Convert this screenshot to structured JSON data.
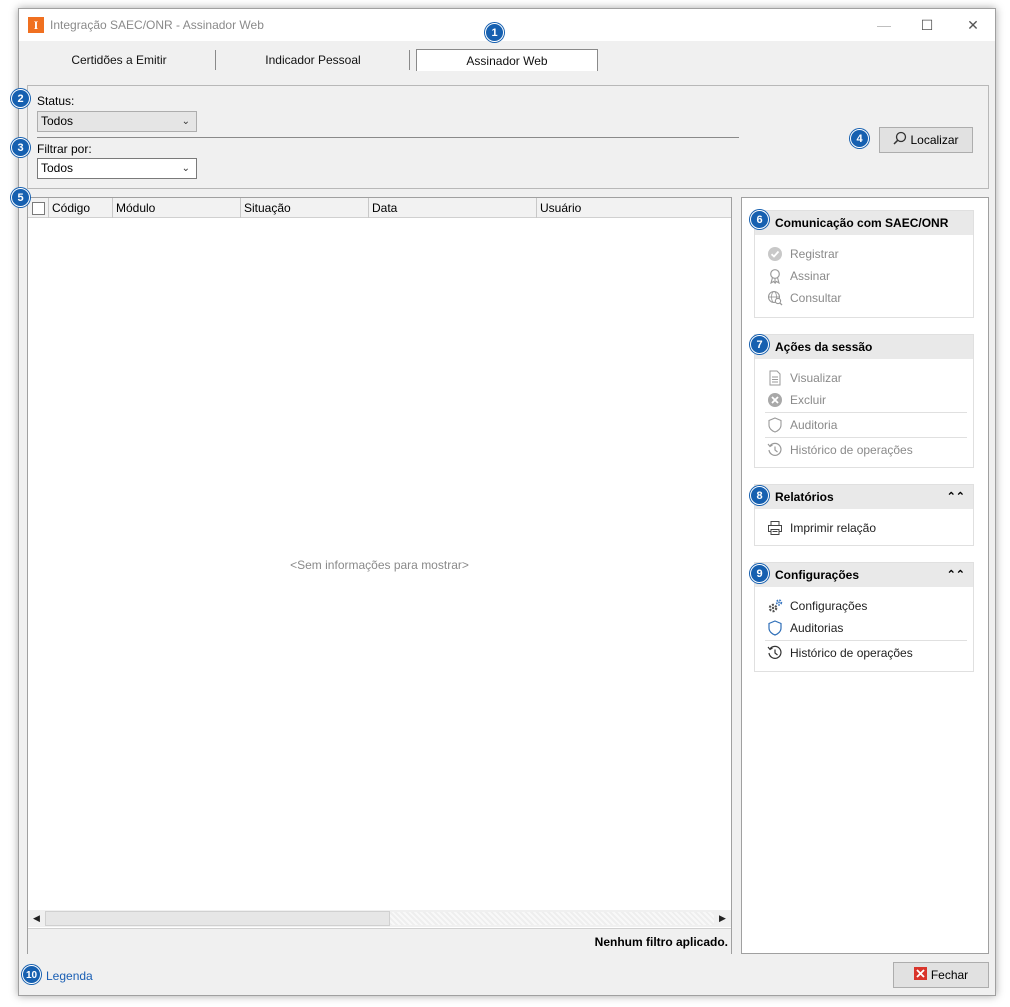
{
  "window": {
    "title": "Integração SAEC/ONR - Assinador Web",
    "app_icon_letter": "I",
    "minimize": "—",
    "maximize": "☐",
    "close": "✕"
  },
  "tabs": [
    {
      "label": "Certidões a Emitir",
      "active": false
    },
    {
      "label": "Indicador Pessoal",
      "active": false
    },
    {
      "label": "Assinador Web",
      "active": true
    }
  ],
  "filters": {
    "status_label": "Status:",
    "status_value": "Todos",
    "filter_label": "Filtrar por:",
    "filter_value": "Todos",
    "search_button": "Localizar"
  },
  "grid": {
    "columns": [
      "Código",
      "Módulo",
      "Situação",
      "Data",
      "Usuário"
    ],
    "empty_message": "<Sem informações para mostrar>",
    "status": "Nenhum filtro aplicado."
  },
  "side": {
    "comunicacao": {
      "title": "Comunicação com SAEC/ONR",
      "items": [
        "Registrar",
        "Assinar",
        "Consultar"
      ]
    },
    "acoes": {
      "title": "Ações da sessão",
      "items": [
        "Visualizar",
        "Excluir",
        "Auditoria",
        "Histórico de operações"
      ]
    },
    "relatorios": {
      "title": "Relatórios",
      "items": [
        "Imprimir relação"
      ]
    },
    "configuracoes": {
      "title": "Configurações",
      "items": [
        "Configurações",
        "Auditorias",
        "Histórico de operações"
      ]
    }
  },
  "footer": {
    "legend_link": "Legenda",
    "close_button": "Fechar"
  },
  "badges": [
    "1",
    "2",
    "3",
    "4",
    "5",
    "6",
    "7",
    "8",
    "9",
    "10"
  ],
  "colors": {
    "badge": "#1660b0",
    "app_icon": "#f07020",
    "link": "#1a5fb4",
    "close_x": "#d9342b"
  }
}
